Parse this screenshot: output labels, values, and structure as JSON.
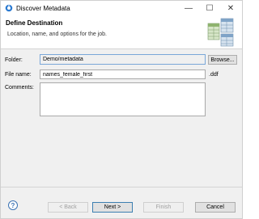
{
  "window": {
    "title": "Discover Metadata",
    "controls": {
      "minimize": "—",
      "maximize": "☐",
      "close": "✕"
    }
  },
  "banner": {
    "title": "Define Destination",
    "description": "Location, name, and options for the job."
  },
  "form": {
    "folder_label": "Folder:",
    "folder_value": "Demo/metadata",
    "browse_label": "Browse...",
    "filename_label": "File name:",
    "filename_value": "names_female_first",
    "filename_extension": ".ddf",
    "comments_label": "Comments:",
    "comments_value": ""
  },
  "footer": {
    "help_label": "?",
    "back_label": "< Back",
    "next_label": "Next >",
    "finish_label": "Finish",
    "cancel_label": "Cancel"
  }
}
